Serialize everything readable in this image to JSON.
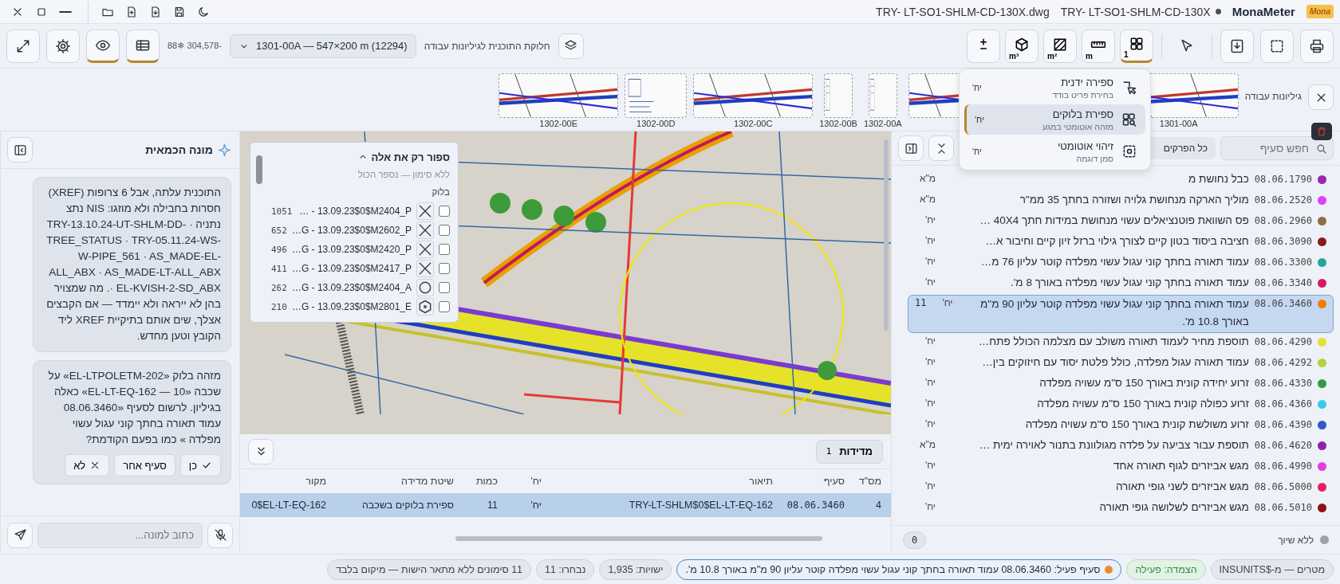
{
  "title_bar": {
    "logo": "Mona",
    "app_name": "MonaMeter",
    "document_title": "TRY- LT-SO1-SHLM-CD-130X",
    "unsaved": true,
    "file_name": "TRY- LT-SO1-SHLM-CD-130X.dwg",
    "file_actions": [
      {
        "kind": "moon"
      },
      {
        "kind": "save"
      },
      {
        "kind": "file-down"
      },
      {
        "kind": "file-plus"
      },
      {
        "kind": "folder"
      }
    ],
    "window_controls": [
      {
        "kind": "minimize"
      },
      {
        "kind": "maximize"
      },
      {
        "kind": "close"
      }
    ]
  },
  "toolbar": {
    "output_tools": [
      {
        "kind": "print"
      },
      {
        "kind": "select"
      },
      {
        "kind": "download"
      }
    ],
    "pointer_tool": {
      "kind": "cursor",
      "selected": false
    },
    "measure_tools": [
      {
        "kind": "count",
        "label": "1",
        "selected": true
      },
      {
        "kind": "length",
        "label": "m",
        "selected": false
      },
      {
        "kind": "area",
        "label": "m²",
        "selected": false
      },
      {
        "kind": "volume",
        "label": "m³",
        "selected": false
      },
      {
        "kind": "deduct",
        "selected": false
      }
    ],
    "sheet_split": {
      "label": "חלוקת התוכנית לגיליונות עבודה",
      "value": "1301-00A — 547×200 m (12294)"
    },
    "coordinates": "88❄ 304,578-",
    "view_buttons": [
      {
        "kind": "table",
        "on": true
      },
      {
        "kind": "eye",
        "on": true
      },
      {
        "kind": "settings",
        "on": false
      },
      {
        "kind": "expand",
        "on": false
      }
    ]
  },
  "sheets": {
    "title": "גיליונות עבודה",
    "items": [
      {
        "label": "1301-00A",
        "kind": "plan"
      },
      {
        "kind": "plan"
      },
      {
        "label": "1302-00A",
        "kind": "portrait"
      },
      {
        "label": "1302-00B",
        "kind": "portrait"
      },
      {
        "label": "1302-00C",
        "kind": "plan"
      },
      {
        "label": "1302-00D",
        "kind": "sheet"
      },
      {
        "label": "1302-00E",
        "kind": "plan"
      }
    ]
  },
  "count_menu": {
    "items": [
      {
        "kind": "manual",
        "title": "ספירה ידנית",
        "subtitle": "בחירת פריט בודד",
        "unit": "יח'",
        "selected": false
      },
      {
        "kind": "blocks",
        "title": "ספירת בלוקים",
        "subtitle": "מזהה אוטומטי במגע",
        "unit": "יח'",
        "selected": true
      },
      {
        "kind": "auto",
        "title": "זיהוי אוטומטי",
        "subtitle": "סמן דוגמה",
        "unit": "יח'",
        "selected": false
      }
    ]
  },
  "items_panel": {
    "search": {
      "placeholder": "חפש סעיף"
    },
    "chapter_filter": "כל הפרקים",
    "items": [
      {
        "code": "08.06.1790",
        "description": "כבל נחושת מ",
        "unit": "מ\"א",
        "color": "#9c27b0",
        "selected": false
      },
      {
        "code": "08.06.2520",
        "description": "מוליך הארקה מנחושת גלויה ושזורה בחתך 35 ממ\"ר",
        "unit": "מ\"א",
        "color": "#e040fb",
        "selected": false
      },
      {
        "code": "08.06.2960",
        "description": "פס השוואת פוטנציאלים עשוי מנחושת במידות חתך 40X4 …",
        "unit": "יח'",
        "color": "#8d6e3f",
        "selected": false
      },
      {
        "code": "08.06.3090",
        "description": "חציבה ביסוד בטון קיים לצורך גילוי ברזל זיון קיים וחיבור א…",
        "unit": "יח'",
        "color": "#8b1a1a",
        "selected": false
      },
      {
        "code": "08.06.3300",
        "description": "עמוד תאורה בחתך קוני עגול עשוי מפלדה קוטר עליון 76 מ…",
        "unit": "יח'",
        "color": "#26a69a",
        "selected": false
      },
      {
        "code": "08.06.3340",
        "description": "עמוד תאורה בחתך קוני עגול עשוי מפלדה באורך 8 מ'.",
        "unit": "יח'",
        "color": "#d81b60",
        "selected": false
      },
      {
        "code": "08.06.3460",
        "description": "עמוד תאורה בחתך קוני עגול עשוי מפלדה קוטר עליון 90 מ\"מ באורך 10.8 מ'.",
        "unit": "יח'",
        "count": "11",
        "color": "#f57c00",
        "selected": true
      },
      {
        "code": "08.06.4290",
        "description": "תוספת מחיר לעמוד תאורה משולב עם מצלמה הכולל פתח…",
        "unit": "יח'",
        "color": "#e6e030",
        "selected": false
      },
      {
        "code": "08.06.4292",
        "description": "עמוד תאורה עגול מפלדה, כולל פלטת יסוד עם חיזוקים בין…",
        "unit": "יח'",
        "color": "#b5d33a",
        "selected": false
      },
      {
        "code": "08.06.4330",
        "description": "זרוע יחידה קונית באורך 150 ס\"מ עשויה מפלדה",
        "unit": "יח'",
        "color": "#2e9e44",
        "selected": false
      },
      {
        "code": "08.06.4360",
        "description": "זרוע כפולה קונית באורך 150 ס\"מ עשויה מפלדה",
        "unit": "יח'",
        "color": "#3ec8e8",
        "selected": false
      },
      {
        "code": "08.06.4390",
        "description": "זרוע משולשת קונית באורך 150 ס\"מ עשויה מפלדה",
        "unit": "יח'",
        "color": "#3058c8",
        "selected": false
      },
      {
        "code": "08.06.4620",
        "description": "תוספת עבור צביעה על פלדה מגולוונת בתנור לאוירה ימית …",
        "unit": "מ\"א",
        "color": "#8e24aa",
        "selected": false
      },
      {
        "code": "08.06.4990",
        "description": "מגש אביזרים לגוף תאורה אחד",
        "unit": "יח'",
        "color": "#e040e0",
        "selected": false
      },
      {
        "code": "08.06.5000",
        "description": "מגש אביזרים לשני גופי תאורה",
        "unit": "יח'",
        "color": "#e91e63",
        "selected": false
      },
      {
        "code": "08.06.5010",
        "description": "מגש אביזרים לשלושה גופי תאורה",
        "unit": "יח'",
        "color": "#901010",
        "selected": false
      }
    ],
    "unassigned": {
      "label": "ללא שיוך",
      "count": "0"
    }
  },
  "count_filter": {
    "title": "ספור רק את אלה",
    "expanded": true,
    "hint": "ללא סימון — נספר הכול",
    "column": "בלוק",
    "blocks": [
      {
        "checked": false,
        "kind": "cross",
        "name": "… - 13.09.23$0$M2404_P",
        "count": "1051"
      },
      {
        "checked": false,
        "kind": "cross",
        "name": "…G - 13.09.23$0$M2602_P",
        "count": "652"
      },
      {
        "checked": false,
        "kind": "cross",
        "name": "…G - 13.09.23$0$M2420_P",
        "count": "496"
      },
      {
        "checked": false,
        "kind": "cross",
        "name": "…G - 13.09.23$0$M2417_P",
        "count": "411"
      },
      {
        "checked": false,
        "kind": "circle",
        "name": "…G - 13.09.23$0$M2404_A",
        "count": "262"
      },
      {
        "checked": false,
        "kind": "hexagon",
        "name": "…G - 13.09.23$0$M2801_E",
        "count": "210"
      }
    ]
  },
  "measurements": {
    "title": "מדידות",
    "count": "1",
    "columns": [
      "מס\"ד",
      "סעיף",
      "תיאור",
      "יח'",
      "כמות",
      "שיטת מדידה",
      "מקור"
    ],
    "rows": [
      {
        "selected": true,
        "cells": [
          "4",
          "08.06.3460",
          "TRY-LT-SHLM$0$EL-LT-EQ-162",
          "יח'",
          "11",
          "ספירת בלוקים בשכבה",
          "0$EL-LT-EQ-162"
        ]
      }
    ]
  },
  "assistant": {
    "title": "מונה הכמאית",
    "messages": [
      {
        "text": "התוכנית עלתה, אבל 6 צרופות (XREF) חסרות בחבילה ולא מוזגו: NIS נתצ נתניה · TRY-13.10.24-UT-SHLM-DD-TREE_STATUS · TRY-05.11.24-WS-W-PIPE_561 · AS_MADE-EL-ALL_ABX · AS_MADE-LT-ALL_ABX · EL-KVISH-2-SD_ABX. מה שמצויר בהן לא ייראה ולא יימדד — אם הקבצים אצלך, שים אותם בתיקיית XREF ליד הקובץ וטען מחדש."
      },
      {
        "text": "מזהה בלוק «EL-LTPOLETM-202» על שכבה «10 — EL-LT-EQ-162» כאלה בגיליון. לרשום לסעיף «08.06.3460 עמוד תאורה בחתך קוני עגול עשוי מפלדה » כמו בפעם הקודמת?",
        "actions": [
          {
            "kind": "yes",
            "label": "כן"
          },
          {
            "kind": "other",
            "label": "סעיף אחר"
          },
          {
            "kind": "no",
            "label": "לא"
          }
        ]
      }
    ],
    "input": {
      "placeholder": "כתוב למונה..."
    }
  },
  "status_bar": [
    {
      "kind": "plain",
      "text": "מטרים — מ-$INSUNITS"
    },
    {
      "kind": "success",
      "text": "הצמדה: פעילה"
    },
    {
      "kind": "active",
      "text": "סעיף פעיל: 08.06.3460 עמוד תאורה בחתך קוני עגול עשוי מפלדה קוטר עליון 90 מ\"מ באורך 10.8 מ'."
    },
    {
      "kind": "plain",
      "text": "ישויות: 1,935"
    },
    {
      "kind": "plain",
      "text": "נבחרו: 11"
    },
    {
      "kind": "plain",
      "text": "11 סימונים ללא מתאר הישות — מיקום בלבד"
    }
  ]
}
